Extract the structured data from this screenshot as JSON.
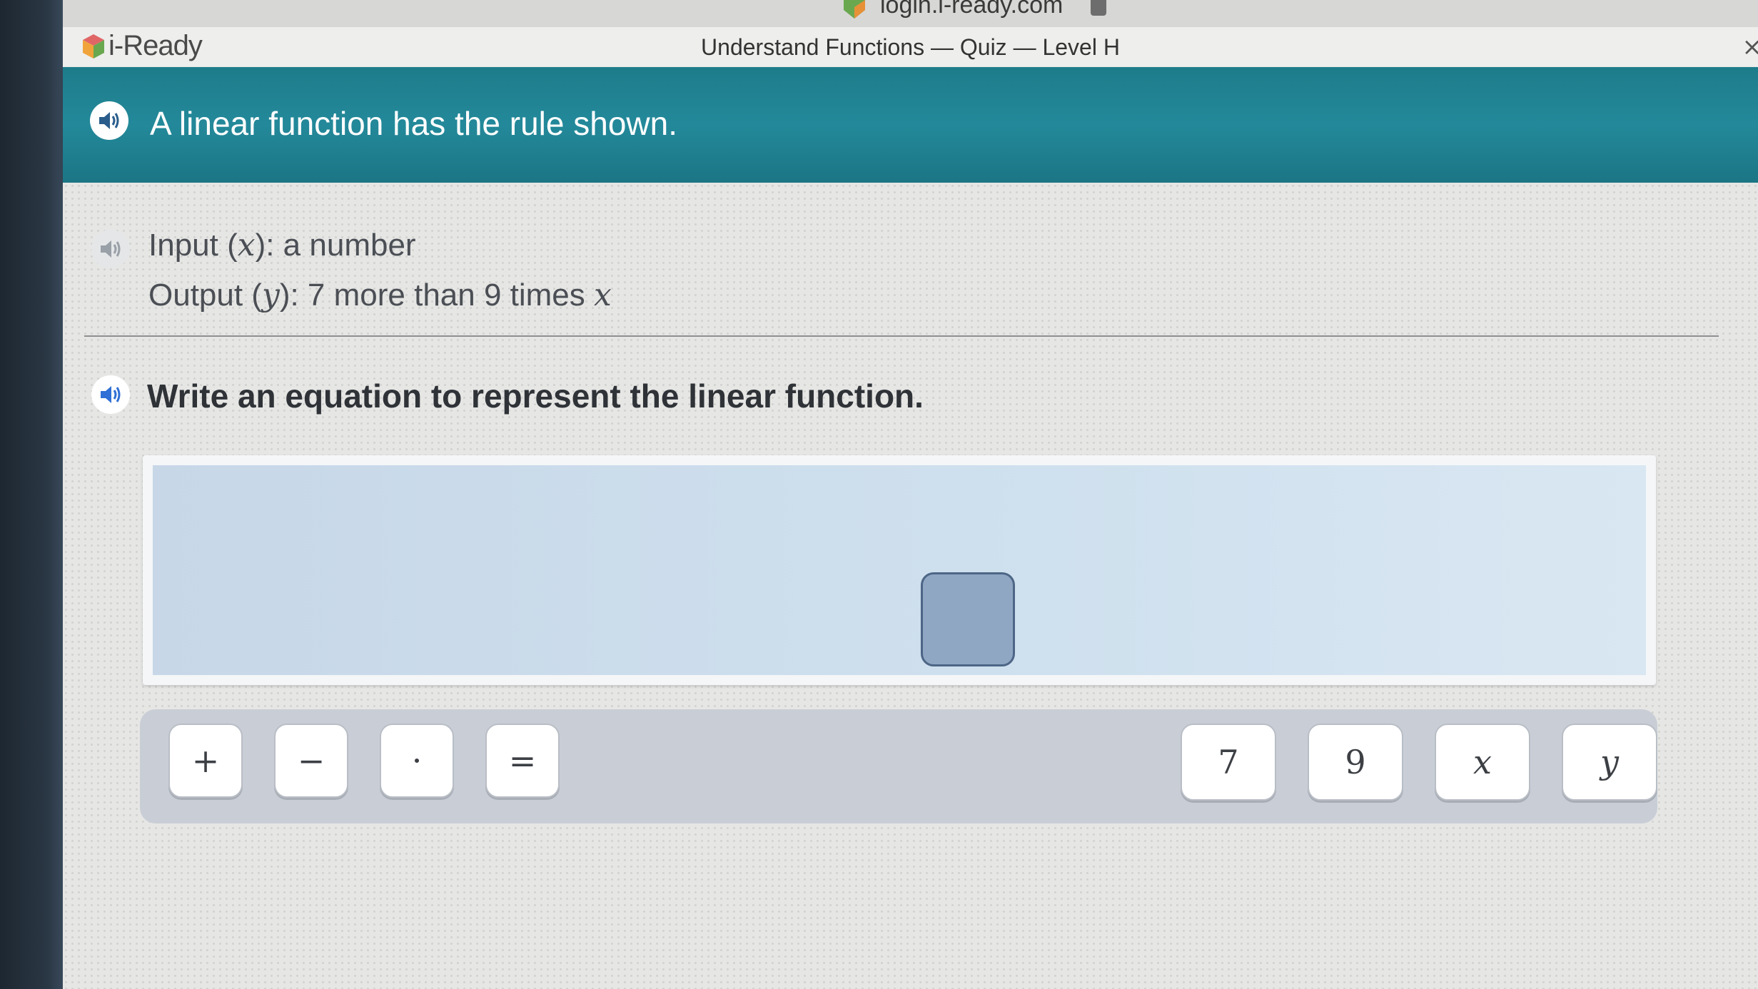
{
  "browser": {
    "url": "login.i-ready.com"
  },
  "header": {
    "brand": "i-Ready",
    "lesson_title": "Understand Functions — Quiz — Level H",
    "close_label": "×"
  },
  "banner": {
    "text": "A linear function has the rule shown."
  },
  "rule": {
    "input_prefix": "Input (",
    "input_var": "x",
    "input_suffix": "): a number",
    "output_prefix": "Output (",
    "output_var": "y",
    "output_suffix": "): 7 more than 9 times ",
    "output_end_var": "x"
  },
  "question": {
    "text": "Write an equation to represent the linear function."
  },
  "operators": [
    "+",
    "−",
    "·",
    "="
  ],
  "tiles": [
    "7",
    "9",
    "x",
    "y"
  ],
  "colors": {
    "banner": "#23899a",
    "slot": "#90a7c4",
    "accent_speaker": "#2f6fd6"
  }
}
